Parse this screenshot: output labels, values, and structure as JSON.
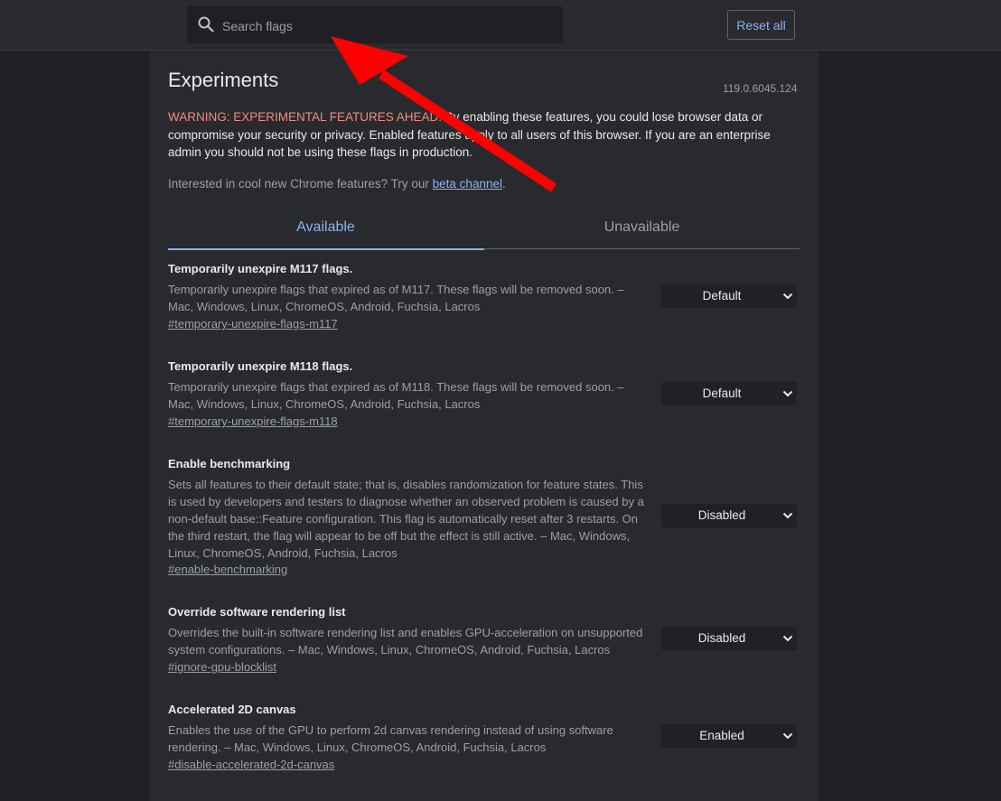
{
  "search": {
    "placeholder": "Search flags"
  },
  "toolbar": {
    "reset_label": "Reset all"
  },
  "header": {
    "title": "Experiments",
    "version": "119.0.6045.124",
    "warning_prefix": "WARNING: EXPERIMENTAL FEATURES AHEAD!",
    "warning_text": " By enabling these features, you could lose browser data or compromise your security or privacy. Enabled features apply to all users of this browser. If you are an enterprise admin you should not be using these flags in production.",
    "promo_text": "Interested in cool new Chrome features? Try our ",
    "promo_link": "beta channel",
    "promo_end": "."
  },
  "tabs": [
    {
      "label": "Available",
      "active": true
    },
    {
      "label": "Unavailable",
      "active": false
    }
  ],
  "flags": [
    {
      "title": "Temporarily unexpire M117 flags.",
      "description": "Temporarily unexpire flags that expired as of M117. These flags will be removed soon. – Mac, Windows, Linux, ChromeOS, Android, Fuchsia, Lacros",
      "link": "#temporary-unexpire-flags-m117",
      "value": "Default"
    },
    {
      "title": "Temporarily unexpire M118 flags.",
      "description": "Temporarily unexpire flags that expired as of M118. These flags will be removed soon. – Mac, Windows, Linux, ChromeOS, Android, Fuchsia, Lacros",
      "link": "#temporary-unexpire-flags-m118",
      "value": "Default"
    },
    {
      "title": "Enable benchmarking",
      "description": "Sets all features to their default state; that is, disables randomization for feature states. This is used by developers and testers to diagnose whether an observed problem is caused by a non-default base::Feature configuration. This flag is automatically reset after 3 restarts. On the third restart, the flag will appear to be off but the effect is still active. – Mac, Windows, Linux, ChromeOS, Android, Fuchsia, Lacros",
      "link": "#enable-benchmarking",
      "value": "Disabled"
    },
    {
      "title": "Override software rendering list",
      "description": "Overrides the built-in software rendering list and enables GPU-acceleration on unsupported system configurations. – Mac, Windows, Linux, ChromeOS, Android, Fuchsia, Lacros",
      "link": "#ignore-gpu-blocklist",
      "value": "Disabled"
    },
    {
      "title": "Accelerated 2D canvas",
      "description": "Enables the use of the GPU to perform 2d canvas rendering instead of using software rendering. – Mac, Windows, Linux, ChromeOS, Android, Fuchsia, Lacros",
      "link": "#disable-accelerated-2d-canvas",
      "value": "Enabled"
    }
  ],
  "colors": {
    "accent": "#8ab4f8",
    "warning": "#f28b82",
    "annotation_arrow": "#ff0000"
  },
  "icons": {
    "search": "search-icon",
    "dropdown": "chevron-down-icon"
  }
}
